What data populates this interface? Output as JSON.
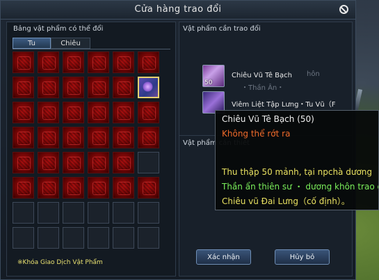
{
  "window": {
    "title": "Cửa hàng trao đổi"
  },
  "left_panel": {
    "header": "Bảng vật phẩm có thể đổi",
    "tabs": [
      "Tu",
      "Chiêu"
    ],
    "footer_note": "※Khóa Giao Dịch Vật Phẩm",
    "grid": {
      "columns": 6,
      "rows": 8,
      "slots": [
        "red",
        "red",
        "red",
        "red",
        "red",
        "red",
        "red",
        "red",
        "red",
        "red",
        "red",
        "selected",
        "red",
        "red",
        "red",
        "red",
        "red",
        "red",
        "red",
        "red",
        "red",
        "red",
        "red",
        "red",
        "red",
        "red",
        "red",
        "red",
        "red",
        "empty",
        "red",
        "red",
        "red",
        "red",
        "red",
        "red",
        "empty",
        "empty",
        "empty",
        "empty",
        "empty",
        "empty",
        "empty",
        "empty",
        "empty",
        "empty",
        "empty",
        "empty"
      ]
    }
  },
  "right_panel": {
    "header_top": "Vật phẩm cần trao đổi",
    "header_bottom": "Vật phẩm cần thiết",
    "items": [
      {
        "name": "Chiêu Vũ Tê Bạch",
        "quantity": "50",
        "icon": "feather-scroll-icon"
      },
      {
        "name": "Viêm Liệt Tập Lưng・Tu Vũ（F",
        "quantity": "",
        "icon": "armor-piece-icon"
      }
    ],
    "ghost_texts": [
      "hôn",
      "・Thần Ân・"
    ]
  },
  "buttons": {
    "confirm": "Xác nhận",
    "cancel": "Hủy bỏ"
  },
  "tooltip": {
    "title": "Chiêu Vũ Tê Bạch (50)",
    "warning": "Không thể rớt ra",
    "lines": [
      {
        "text": "Thu thập 50 mảnh, tại npchà dương",
        "color": "#e8e060"
      },
      {
        "text": "Thần ẩn thiên sư ・ dương khôn trao đổi",
        "color": "#7aee5a"
      },
      {
        "text": "Chiêu vũ Đai Lưng（cố định）。",
        "color": "#e8e060"
      }
    ]
  }
}
